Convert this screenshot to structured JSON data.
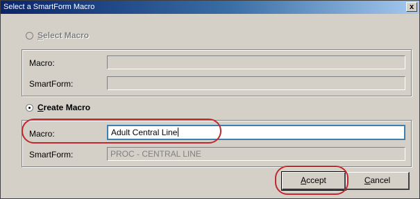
{
  "window": {
    "title": "Select a SmartForm Macro",
    "close_glyph": "x"
  },
  "select_macro": {
    "label_mnemonic": "S",
    "label_rest": "elect Macro",
    "selected": false,
    "enabled": false,
    "macro_label": "Macro:",
    "macro_value": "",
    "smartform_label": "SmartForm:",
    "smartform_value": ""
  },
  "create_macro": {
    "label_mnemonic": "C",
    "label_rest": "reate Macro",
    "selected": true,
    "macro_label": "Macro:",
    "macro_value": "Adult Central Line",
    "smartform_label": "SmartForm:",
    "smartform_value": "PROC - CENTRAL LINE"
  },
  "buttons": {
    "accept_mnemonic": "A",
    "accept_rest": "ccept",
    "cancel_mnemonic": "C",
    "cancel_rest": "ancel"
  },
  "annotation_color": "#c0282d"
}
